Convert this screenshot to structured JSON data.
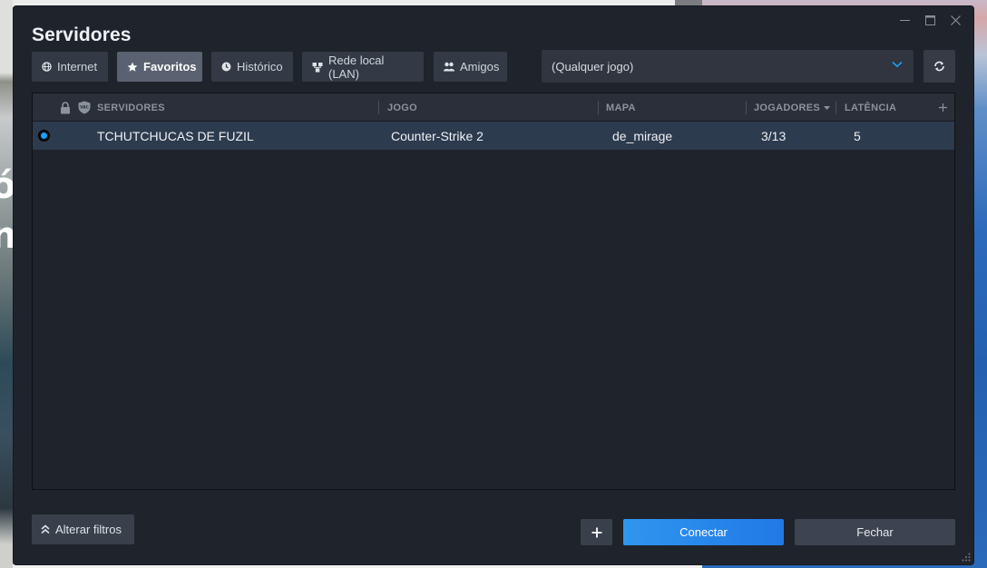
{
  "window": {
    "title": "Servidores",
    "controls": [
      "minimize",
      "maximize",
      "close"
    ]
  },
  "tabs": [
    {
      "label": "Internet",
      "icon": "globe-icon",
      "active": false
    },
    {
      "label": "Favoritos",
      "icon": "star-icon",
      "active": true
    },
    {
      "label": "Histórico",
      "icon": "clock-icon",
      "active": false
    },
    {
      "label": "Rede local (LAN)",
      "icon": "lan-icon",
      "active": false
    },
    {
      "label": "Amigos",
      "icon": "friends-icon",
      "active": false
    }
  ],
  "game_filter": {
    "value": "(Qualquer jogo)"
  },
  "table": {
    "columns": {
      "servers": "SERVIDORES",
      "game": "JOGO",
      "map": "MAPA",
      "players": "JOGADORES",
      "latency": "LATÊNCIA"
    },
    "header_icons": [
      "lock-icon",
      "vac-shield-icon",
      "sort-desc-icon",
      "add-column-icon"
    ],
    "vac_label": "VAC",
    "rows": [
      {
        "server": "TCHUTCHUCAS DE FUZIL",
        "game": "Counter-Strike 2",
        "map": "de_mirage",
        "players": "3/13",
        "latency": "5",
        "selected": true
      }
    ]
  },
  "footer": {
    "filters_label": "Alterar filtros",
    "add_label": "+",
    "connect_label": "Conectar",
    "close_label": "Fechar"
  },
  "colors": {
    "dialog_bg": "#1f232c",
    "accent_blue": "#1a9fff",
    "selected_row": "#2d3b4e",
    "tab_active": "#5a6170"
  }
}
